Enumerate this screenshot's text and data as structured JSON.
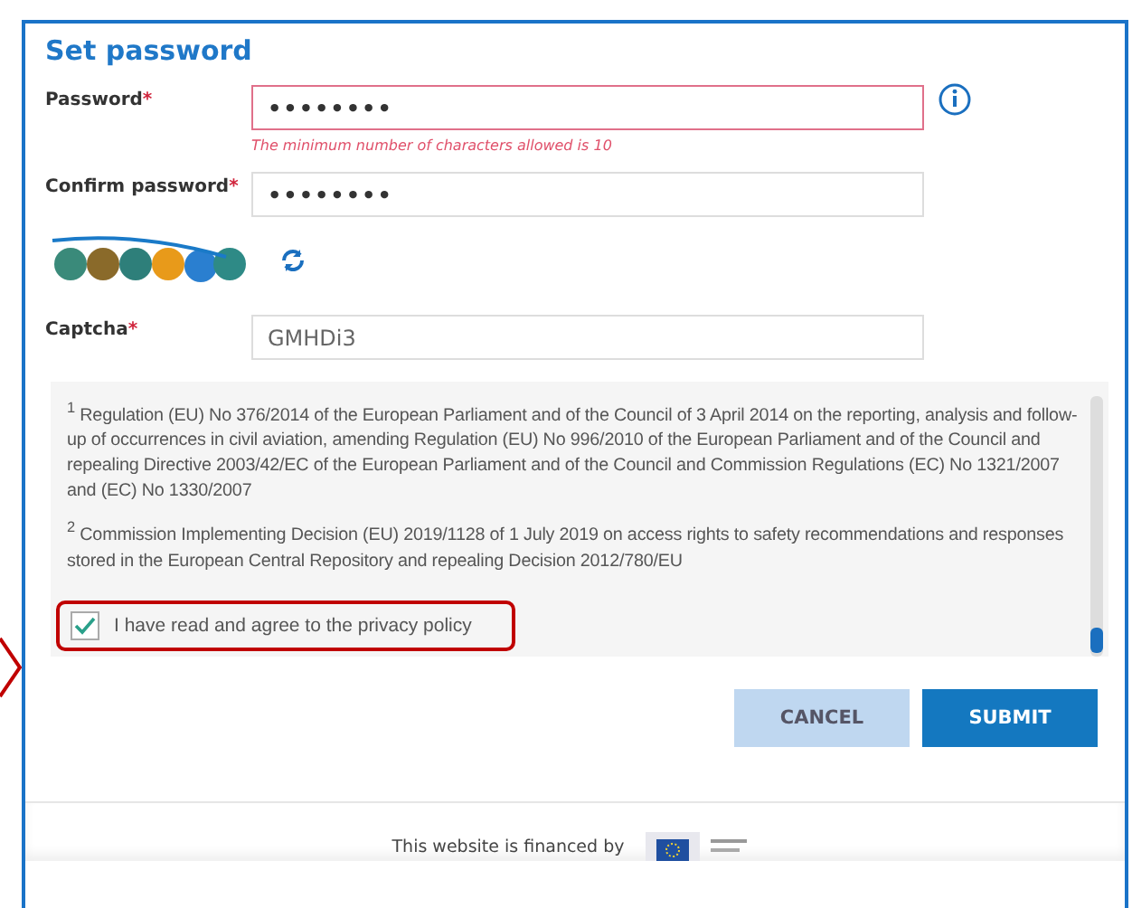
{
  "dialog": {
    "title": "Set password"
  },
  "fields": [
    {
      "kind": "password",
      "label": "Password",
      "required_mark": "*",
      "value": "••••••••",
      "invalid": true,
      "error": "The minimum number of characters allowed is 10",
      "info": true
    },
    {
      "kind": "password",
      "label": "Confirm password",
      "required_mark": "*",
      "value": "••••••••",
      "invalid": false
    },
    {
      "kind": "captcha-image"
    },
    {
      "kind": "text",
      "label": "Captcha",
      "required_mark": "*",
      "value": "GMHDi3",
      "invalid": false
    }
  ],
  "notes": [
    "$^{1}$ Regulation (EU) No 376/2014 of the European Parliament and of the Council of 3 April 2014 on the reporting, analysis and follow-up of occurrences in civil aviation, amending Regulation (EU) No 996/2010 of the European Parliament and of the Council and repealing Directive 2003/42/EC of the European Parliament and of the Council and Commission Regulations (EC) No 1321/2007 and (EC) No 1330/2007",
    "$^{2}$ Commission Implementing Decision (EU) 2019/1128 of 1 July 2019 on access rights to safety recommendations and responses stored in the European Central Repository and repealing Decision 2012/780/EU"
  ],
  "consent": {
    "label": "I have read and agree to the privacy policy",
    "checked": true,
    "highlighted": true
  },
  "buttons": [
    {
      "label": "CANCEL",
      "kind": "secondary"
    },
    {
      "label": "SUBMIT",
      "kind": "primary"
    }
  ],
  "footer": {
    "text": "This website is financed by"
  }
}
